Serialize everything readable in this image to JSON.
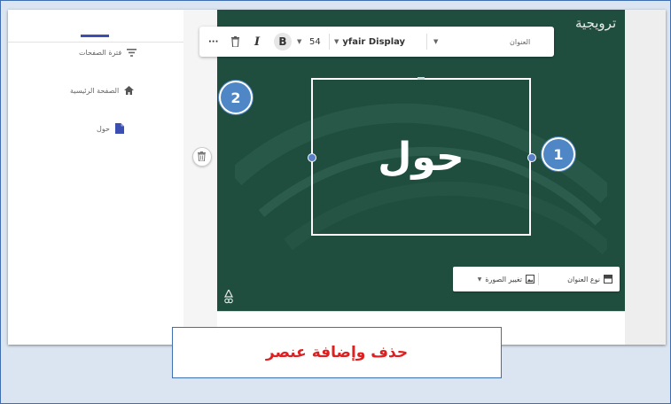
{
  "sidebar": {
    "filter_label": "فترة الصفحات",
    "filter_icon": "filter-icon",
    "items": [
      {
        "label": "الصفحة الرئيسية",
        "icon": "home-icon"
      },
      {
        "label": "حول",
        "icon": "page-icon"
      }
    ]
  },
  "canvas": {
    "header_title": "ترويجية",
    "textbox_text": "حول",
    "background_color": "#1f4e3f"
  },
  "toolbar": {
    "more_label": "···",
    "bold_label": "B",
    "italic_label": "I",
    "font_size": "54",
    "font_name": "yfair Display",
    "style_label": "العنوان"
  },
  "bottombar": {
    "change_image_label": "تغيير الصورة",
    "header_type_label": "نوع العنوان"
  },
  "callouts": {
    "one": "1",
    "two": "2",
    "color": "#4f86c6"
  },
  "caption": {
    "text": "حذف وإضافة عنصر",
    "color": "#e02020"
  }
}
